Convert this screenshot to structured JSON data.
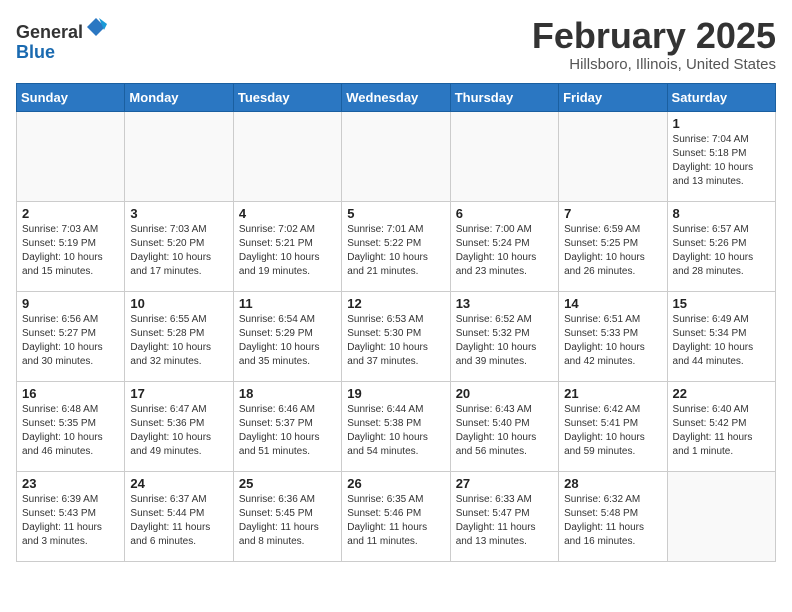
{
  "header": {
    "logo_line1": "General",
    "logo_line2": "Blue",
    "title": "February 2025",
    "subtitle": "Hillsboro, Illinois, United States"
  },
  "weekdays": [
    "Sunday",
    "Monday",
    "Tuesday",
    "Wednesday",
    "Thursday",
    "Friday",
    "Saturday"
  ],
  "weeks": [
    [
      {
        "day": "",
        "info": ""
      },
      {
        "day": "",
        "info": ""
      },
      {
        "day": "",
        "info": ""
      },
      {
        "day": "",
        "info": ""
      },
      {
        "day": "",
        "info": ""
      },
      {
        "day": "",
        "info": ""
      },
      {
        "day": "1",
        "info": "Sunrise: 7:04 AM\nSunset: 5:18 PM\nDaylight: 10 hours\nand 13 minutes."
      }
    ],
    [
      {
        "day": "2",
        "info": "Sunrise: 7:03 AM\nSunset: 5:19 PM\nDaylight: 10 hours\nand 15 minutes."
      },
      {
        "day": "3",
        "info": "Sunrise: 7:03 AM\nSunset: 5:20 PM\nDaylight: 10 hours\nand 17 minutes."
      },
      {
        "day": "4",
        "info": "Sunrise: 7:02 AM\nSunset: 5:21 PM\nDaylight: 10 hours\nand 19 minutes."
      },
      {
        "day": "5",
        "info": "Sunrise: 7:01 AM\nSunset: 5:22 PM\nDaylight: 10 hours\nand 21 minutes."
      },
      {
        "day": "6",
        "info": "Sunrise: 7:00 AM\nSunset: 5:24 PM\nDaylight: 10 hours\nand 23 minutes."
      },
      {
        "day": "7",
        "info": "Sunrise: 6:59 AM\nSunset: 5:25 PM\nDaylight: 10 hours\nand 26 minutes."
      },
      {
        "day": "8",
        "info": "Sunrise: 6:57 AM\nSunset: 5:26 PM\nDaylight: 10 hours\nand 28 minutes."
      }
    ],
    [
      {
        "day": "9",
        "info": "Sunrise: 6:56 AM\nSunset: 5:27 PM\nDaylight: 10 hours\nand 30 minutes."
      },
      {
        "day": "10",
        "info": "Sunrise: 6:55 AM\nSunset: 5:28 PM\nDaylight: 10 hours\nand 32 minutes."
      },
      {
        "day": "11",
        "info": "Sunrise: 6:54 AM\nSunset: 5:29 PM\nDaylight: 10 hours\nand 35 minutes."
      },
      {
        "day": "12",
        "info": "Sunrise: 6:53 AM\nSunset: 5:30 PM\nDaylight: 10 hours\nand 37 minutes."
      },
      {
        "day": "13",
        "info": "Sunrise: 6:52 AM\nSunset: 5:32 PM\nDaylight: 10 hours\nand 39 minutes."
      },
      {
        "day": "14",
        "info": "Sunrise: 6:51 AM\nSunset: 5:33 PM\nDaylight: 10 hours\nand 42 minutes."
      },
      {
        "day": "15",
        "info": "Sunrise: 6:49 AM\nSunset: 5:34 PM\nDaylight: 10 hours\nand 44 minutes."
      }
    ],
    [
      {
        "day": "16",
        "info": "Sunrise: 6:48 AM\nSunset: 5:35 PM\nDaylight: 10 hours\nand 46 minutes."
      },
      {
        "day": "17",
        "info": "Sunrise: 6:47 AM\nSunset: 5:36 PM\nDaylight: 10 hours\nand 49 minutes."
      },
      {
        "day": "18",
        "info": "Sunrise: 6:46 AM\nSunset: 5:37 PM\nDaylight: 10 hours\nand 51 minutes."
      },
      {
        "day": "19",
        "info": "Sunrise: 6:44 AM\nSunset: 5:38 PM\nDaylight: 10 hours\nand 54 minutes."
      },
      {
        "day": "20",
        "info": "Sunrise: 6:43 AM\nSunset: 5:40 PM\nDaylight: 10 hours\nand 56 minutes."
      },
      {
        "day": "21",
        "info": "Sunrise: 6:42 AM\nSunset: 5:41 PM\nDaylight: 10 hours\nand 59 minutes."
      },
      {
        "day": "22",
        "info": "Sunrise: 6:40 AM\nSunset: 5:42 PM\nDaylight: 11 hours\nand 1 minute."
      }
    ],
    [
      {
        "day": "23",
        "info": "Sunrise: 6:39 AM\nSunset: 5:43 PM\nDaylight: 11 hours\nand 3 minutes."
      },
      {
        "day": "24",
        "info": "Sunrise: 6:37 AM\nSunset: 5:44 PM\nDaylight: 11 hours\nand 6 minutes."
      },
      {
        "day": "25",
        "info": "Sunrise: 6:36 AM\nSunset: 5:45 PM\nDaylight: 11 hours\nand 8 minutes."
      },
      {
        "day": "26",
        "info": "Sunrise: 6:35 AM\nSunset: 5:46 PM\nDaylight: 11 hours\nand 11 minutes."
      },
      {
        "day": "27",
        "info": "Sunrise: 6:33 AM\nSunset: 5:47 PM\nDaylight: 11 hours\nand 13 minutes."
      },
      {
        "day": "28",
        "info": "Sunrise: 6:32 AM\nSunset: 5:48 PM\nDaylight: 11 hours\nand 16 minutes."
      },
      {
        "day": "",
        "info": ""
      }
    ]
  ]
}
